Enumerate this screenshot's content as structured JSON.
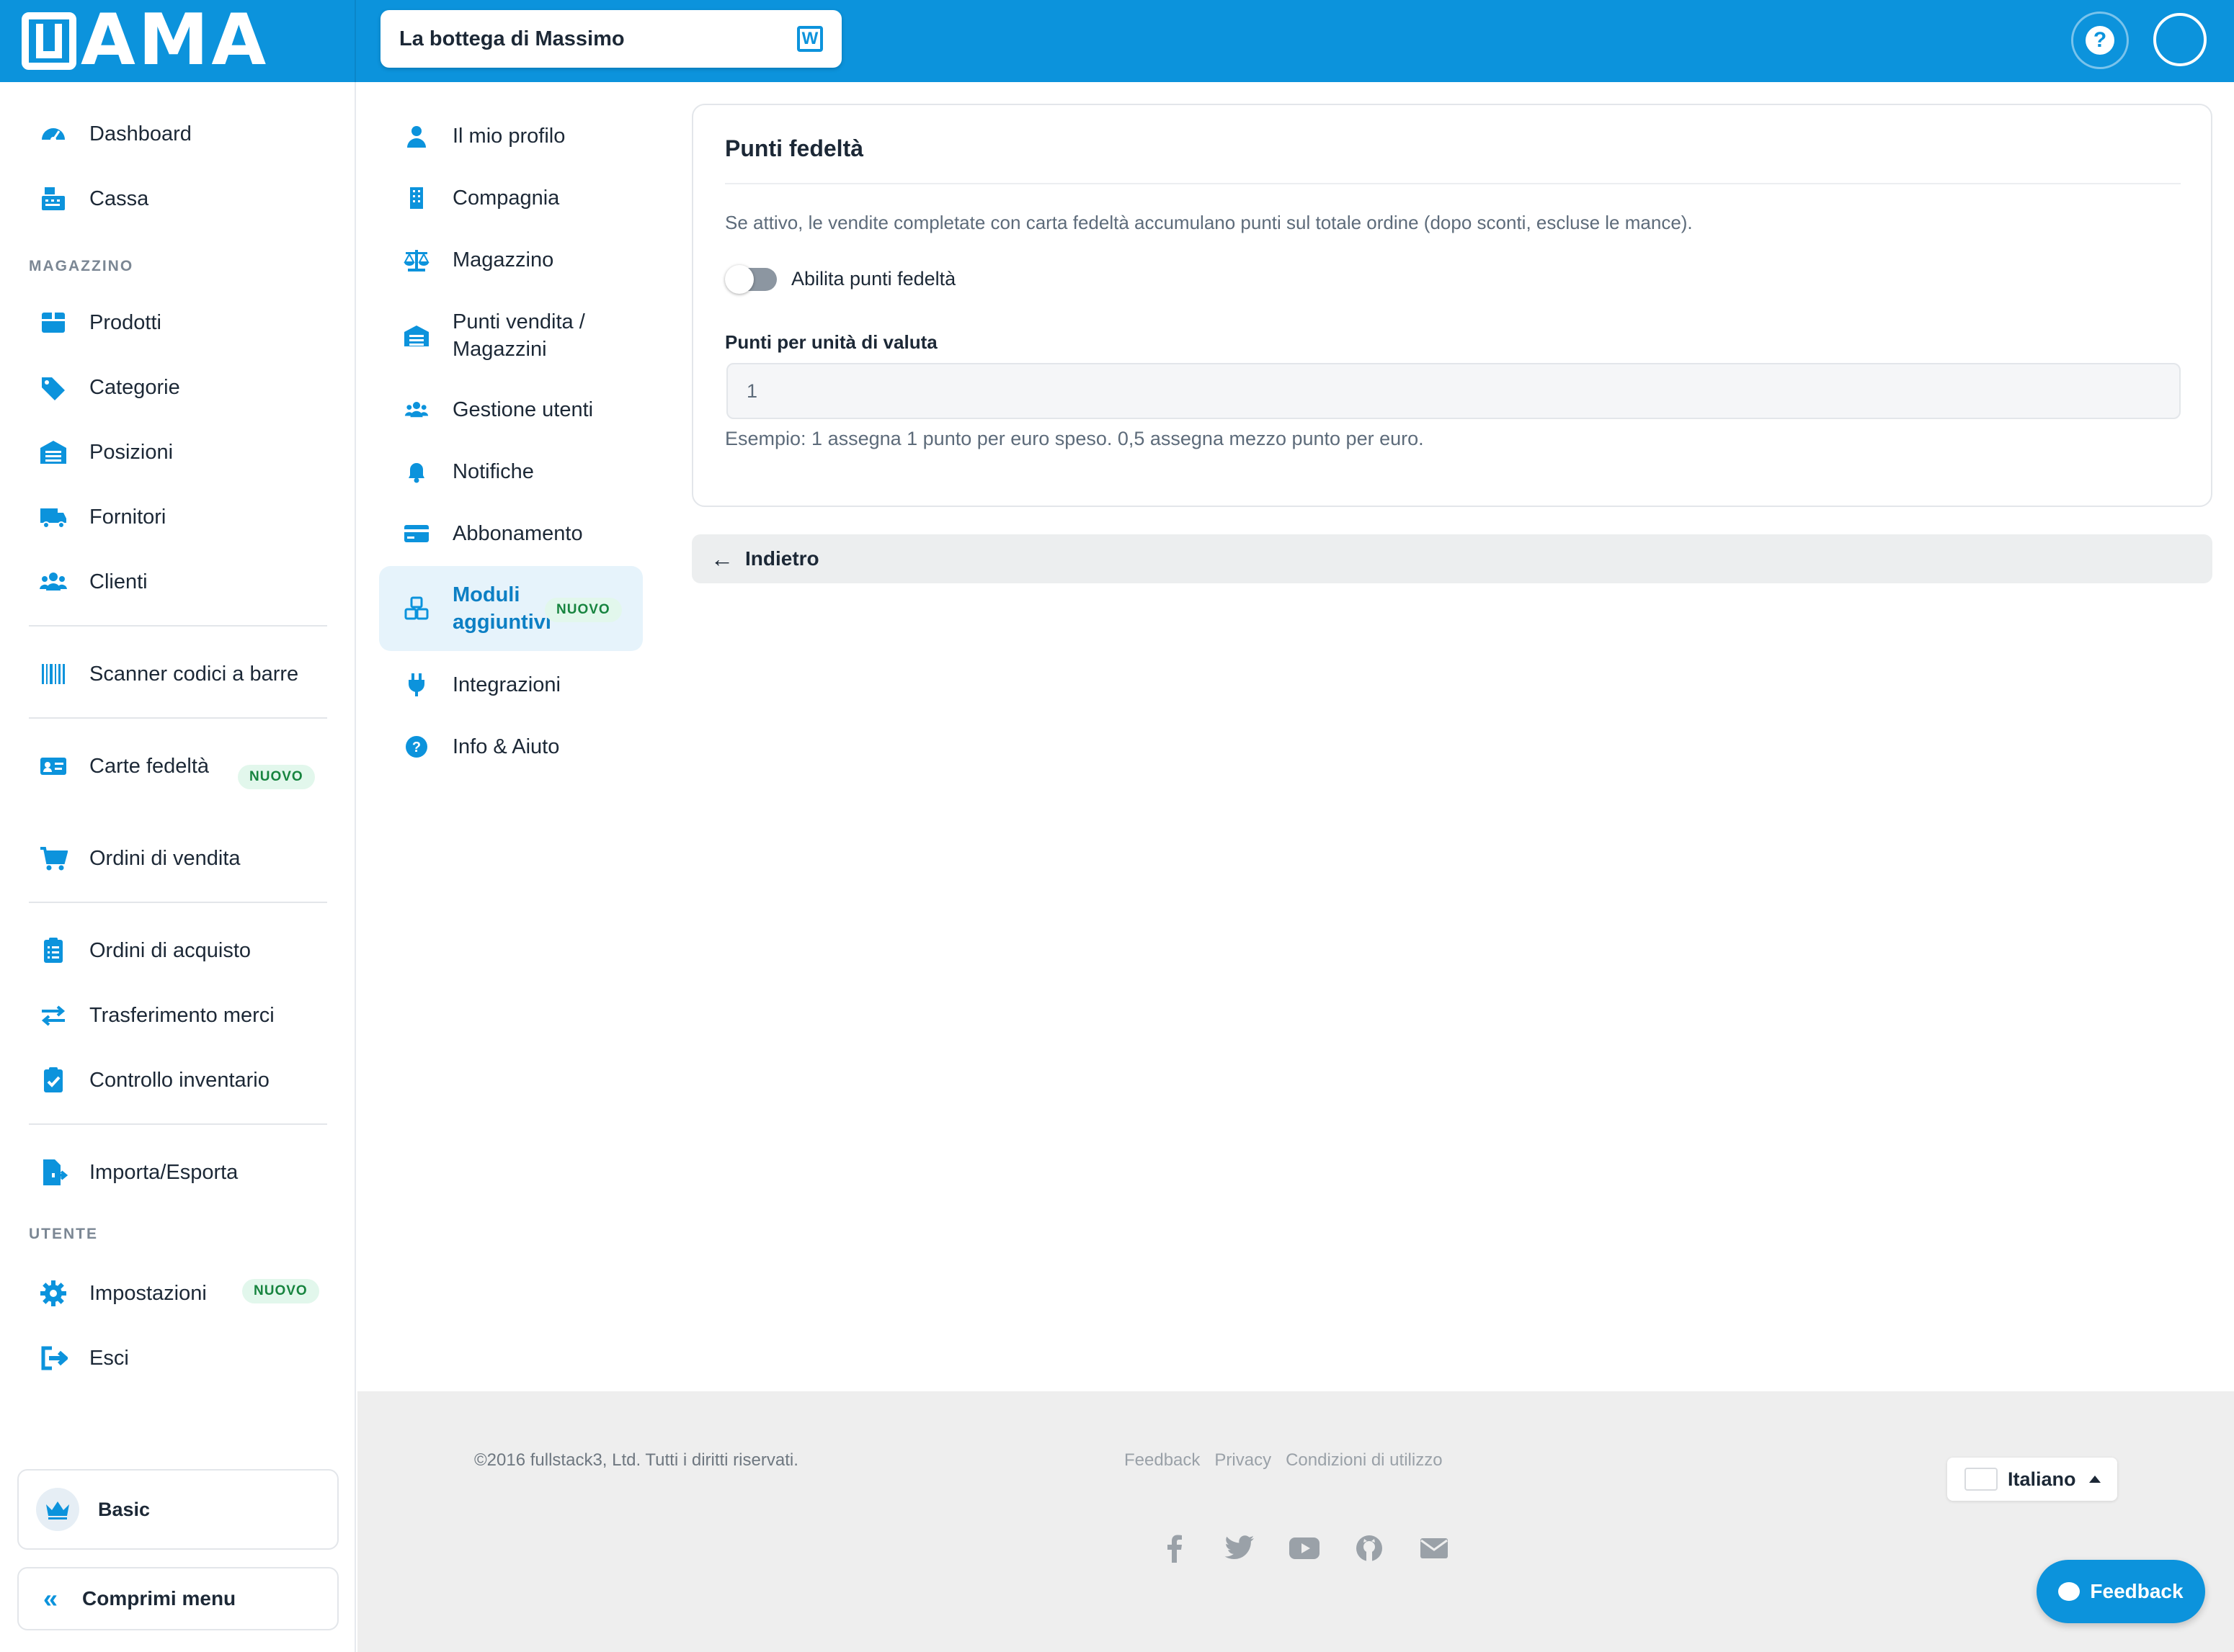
{
  "app": {
    "logo": "WAMA",
    "store_name": "La bottega di Massimo"
  },
  "colors": {
    "primary": "#0c93dc",
    "badge_bg": "#e2f7ec",
    "badge_text": "#17843f"
  },
  "sidebar": {
    "items": [
      {
        "label": "Dashboard",
        "icon": "dashboard-icon"
      },
      {
        "label": "Cassa",
        "icon": "cash-register-icon"
      },
      {
        "label": "Prodotti",
        "icon": "box-icon"
      },
      {
        "label": "Categorie",
        "icon": "tags-icon"
      },
      {
        "label": "Posizioni",
        "icon": "warehouse-icon"
      },
      {
        "label": "Fornitori",
        "icon": "truck-icon"
      },
      {
        "label": "Clienti",
        "icon": "users-icon"
      },
      {
        "label": "Scanner codici a barre",
        "icon": "barcode-icon"
      },
      {
        "label": "Carte fedeltà",
        "icon": "id-card-icon",
        "badge": "NUOVO"
      },
      {
        "label": "Ordini di vendita",
        "icon": "cart-icon"
      },
      {
        "label": "Ordini di acquisto",
        "icon": "clipboard-list-icon"
      },
      {
        "label": "Trasferimento merci",
        "icon": "transfer-icon"
      },
      {
        "label": "Controllo inventario",
        "icon": "clipboard-check-icon"
      },
      {
        "label": "Importa/Esporta",
        "icon": "file-export-icon"
      },
      {
        "label": "Impostazioni",
        "icon": "gear-icon",
        "badge": "NUOVO"
      },
      {
        "label": "Esci",
        "icon": "logout-icon"
      }
    ],
    "section_magazzino": "MAGAZZINO",
    "section_utente": "UTENTE",
    "plan": "Basic",
    "collapse": "Comprimi menu"
  },
  "settings_nav": {
    "items": [
      {
        "label": "Il mio profilo",
        "icon": "user-icon"
      },
      {
        "label": "Compagnia",
        "icon": "building-icon"
      },
      {
        "label": "Magazzino",
        "icon": "scale-icon"
      },
      {
        "label": "Punti vendita / Magazzini",
        "icon": "warehouse-icon"
      },
      {
        "label": "Gestione utenti",
        "icon": "users-icon"
      },
      {
        "label": "Notifiche",
        "icon": "bell-icon"
      },
      {
        "label": "Abbonamento",
        "icon": "credit-card-icon"
      },
      {
        "label": "Moduli aggiuntivi",
        "icon": "cubes-icon",
        "badge": "NUOVO",
        "active": true
      },
      {
        "label": "Integrazioni",
        "icon": "plug-icon"
      },
      {
        "label": "Info & Aiuto",
        "icon": "question-circle-icon"
      }
    ]
  },
  "card": {
    "title": "Punti fedeltà",
    "description": "Se attivo, le vendite completate con carta fedeltà accumulano punti sul totale ordine (dopo sconti, escluse le mance).",
    "toggle_label": "Abilita punti fedeltà",
    "toggle_on": false,
    "field_label": "Punti per unità di valuta",
    "field_value": "1",
    "field_help": "Esempio: 1 assegna 1 punto per euro speso. 0,5 assegna mezzo punto per euro."
  },
  "back_button": "Indietro",
  "footer": {
    "copyright": "©2016 fullstack3, Ltd. Tutti i diritti riservati.",
    "links": [
      "Feedback",
      "Privacy",
      "Condizioni di utilizzo"
    ],
    "social": [
      "facebook-icon",
      "twitter-icon",
      "youtube-icon",
      "github-icon",
      "email-icon"
    ],
    "language": "Italiano"
  },
  "feedback_button": "Feedback"
}
